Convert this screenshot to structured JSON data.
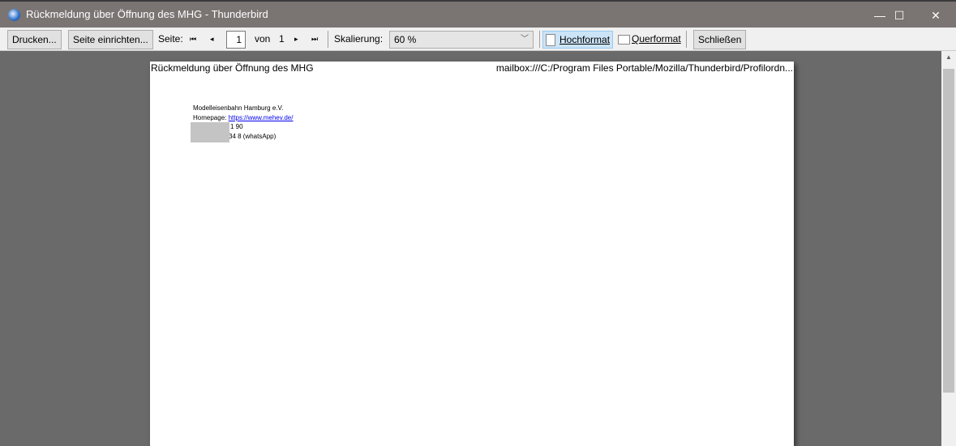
{
  "window": {
    "title": "Rückmeldung über Öffnung des MHG - Thunderbird",
    "minimize": "—",
    "maximize": "☐",
    "close": "✕"
  },
  "toolbar": {
    "print": "Drucken...",
    "page_setup": "Seite einrichten...",
    "page_label": "Seite:",
    "first": "⏮",
    "prev": "◂",
    "page_value": "1",
    "of_label": "von",
    "page_count": "1",
    "next": "▸",
    "last": "⏭",
    "scale_label": "Skalierung:",
    "scale_value": "60 %",
    "portrait": "Hochformat",
    "landscape": "Querformat",
    "close": "Schließen"
  },
  "page": {
    "header_left": "Rückmeldung über Öffnung des MHG",
    "header_right": "mailbox:///C:/Program Files Portable/Mozilla/Thunderbird/Profilordn...",
    "signature": {
      "line1": "Modelleisenbahn Hamburg e.V.",
      "homepage_label": "Homepage: ",
      "homepage_link": "https://www.mehev.de/",
      "line3": "1 90",
      "line4": "34 8 (whatsApp)"
    }
  }
}
